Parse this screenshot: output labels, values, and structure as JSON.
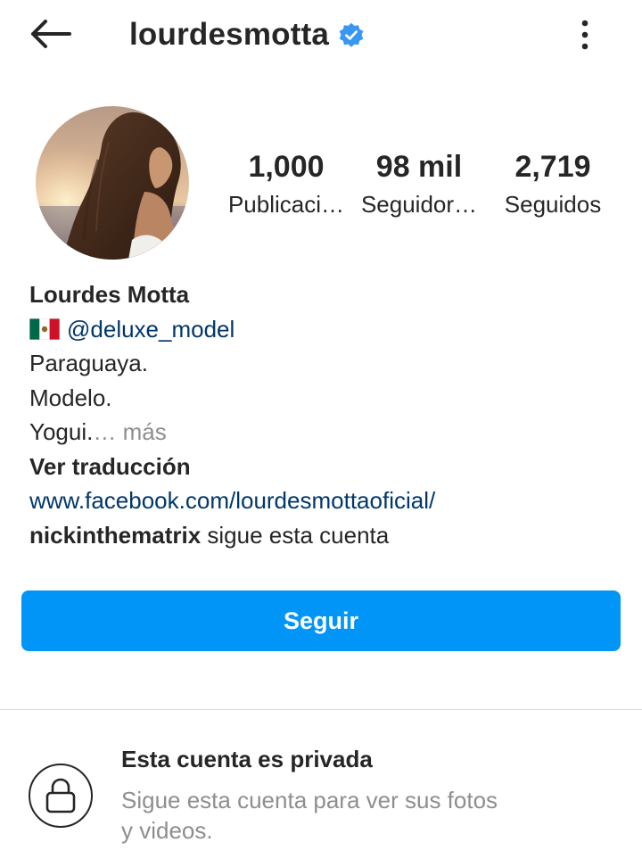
{
  "header": {
    "username": "lourdesmotta",
    "back_icon": "arrow-left-icon",
    "verified_icon": "verified-badge-icon",
    "more_icon": "more-vertical-icon"
  },
  "profile": {
    "avatar_icon": "profile-photo",
    "stats": {
      "posts_value": "1,000",
      "posts_label": "Publicaci…",
      "followers_value": "98 mil",
      "followers_label": "Seguidor…",
      "following_value": "2,719",
      "following_label": "Seguidos"
    }
  },
  "bio": {
    "name": "Lourdes Motta",
    "flag_icon": "mexico-flag-icon",
    "mention": "@deluxe_model",
    "line1": "Paraguaya.",
    "line2": "Modelo.",
    "line3": "Yogui.",
    "more_ellipsis": "… ",
    "more_label": "más",
    "translate_label": "Ver traducción",
    "website": "www.facebook.com/lourdesmottaoficial/",
    "mutual_user": "nickinthematrix",
    "mutual_text": " sigue esta cuenta"
  },
  "actions": {
    "follow_label": "Seguir"
  },
  "private_notice": {
    "lock_icon": "lock-icon",
    "title": "Esta cuenta es privada",
    "description_line1": "Sigue esta cuenta para ver sus fotos",
    "description_line2": "y videos."
  },
  "colors": {
    "accent": "#0095f6",
    "verified": "#3897f0",
    "link": "#00376b",
    "muted": "#8e8e8e",
    "text": "#262626"
  }
}
